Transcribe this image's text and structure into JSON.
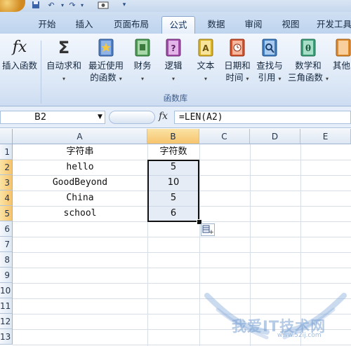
{
  "quick_access": {
    "save_icon": "save-icon",
    "undo_icon": "undo-icon",
    "redo_icon": "redo-icon",
    "camera_icon": "camera-icon",
    "customize_icon": "customize-icon"
  },
  "tabs": [
    {
      "label": "开始"
    },
    {
      "label": "插入"
    },
    {
      "label": "页面布局"
    },
    {
      "label": "公式",
      "active": true
    },
    {
      "label": "数据"
    },
    {
      "label": "审阅"
    },
    {
      "label": "视图"
    },
    {
      "label": "开发工具"
    }
  ],
  "ribbon": {
    "insert_function": "插入函数",
    "autosum": "自动求和",
    "recent": "最近使用",
    "recent_line2": "的函数",
    "financial": "财务",
    "logical": "逻辑",
    "text": "文本",
    "datetime": "日期和",
    "datetime_line2": "时间",
    "lookup": "查找与",
    "lookup_line2": "引用",
    "math": "数学和",
    "math_line2": "三角函数",
    "more": "其他",
    "group_label": "函数库"
  },
  "formula_bar": {
    "name_box": "B2",
    "fx": "fx",
    "formula": "=LEN(A2)"
  },
  "columns": [
    "A",
    "B",
    "C",
    "D",
    "E"
  ],
  "rows": [
    "1",
    "2",
    "3",
    "4",
    "5",
    "6",
    "7",
    "8",
    "9",
    "10",
    "11",
    "12",
    "13"
  ],
  "cells": {
    "A1": "字符串",
    "B1": "字符数",
    "A2": "hello",
    "B2": "5",
    "A3": "GoodBeyond",
    "B3": "10",
    "A4": "China",
    "B4": "5",
    "A5": "school",
    "B5": "6"
  },
  "watermark": {
    "text": "我爱IT技术网",
    "url": "www.52ij.com"
  },
  "colors": {
    "selection_header": "#f6c46d",
    "ribbon_bg": "#dbe7f6",
    "grid_line": "#d7dee8"
  }
}
